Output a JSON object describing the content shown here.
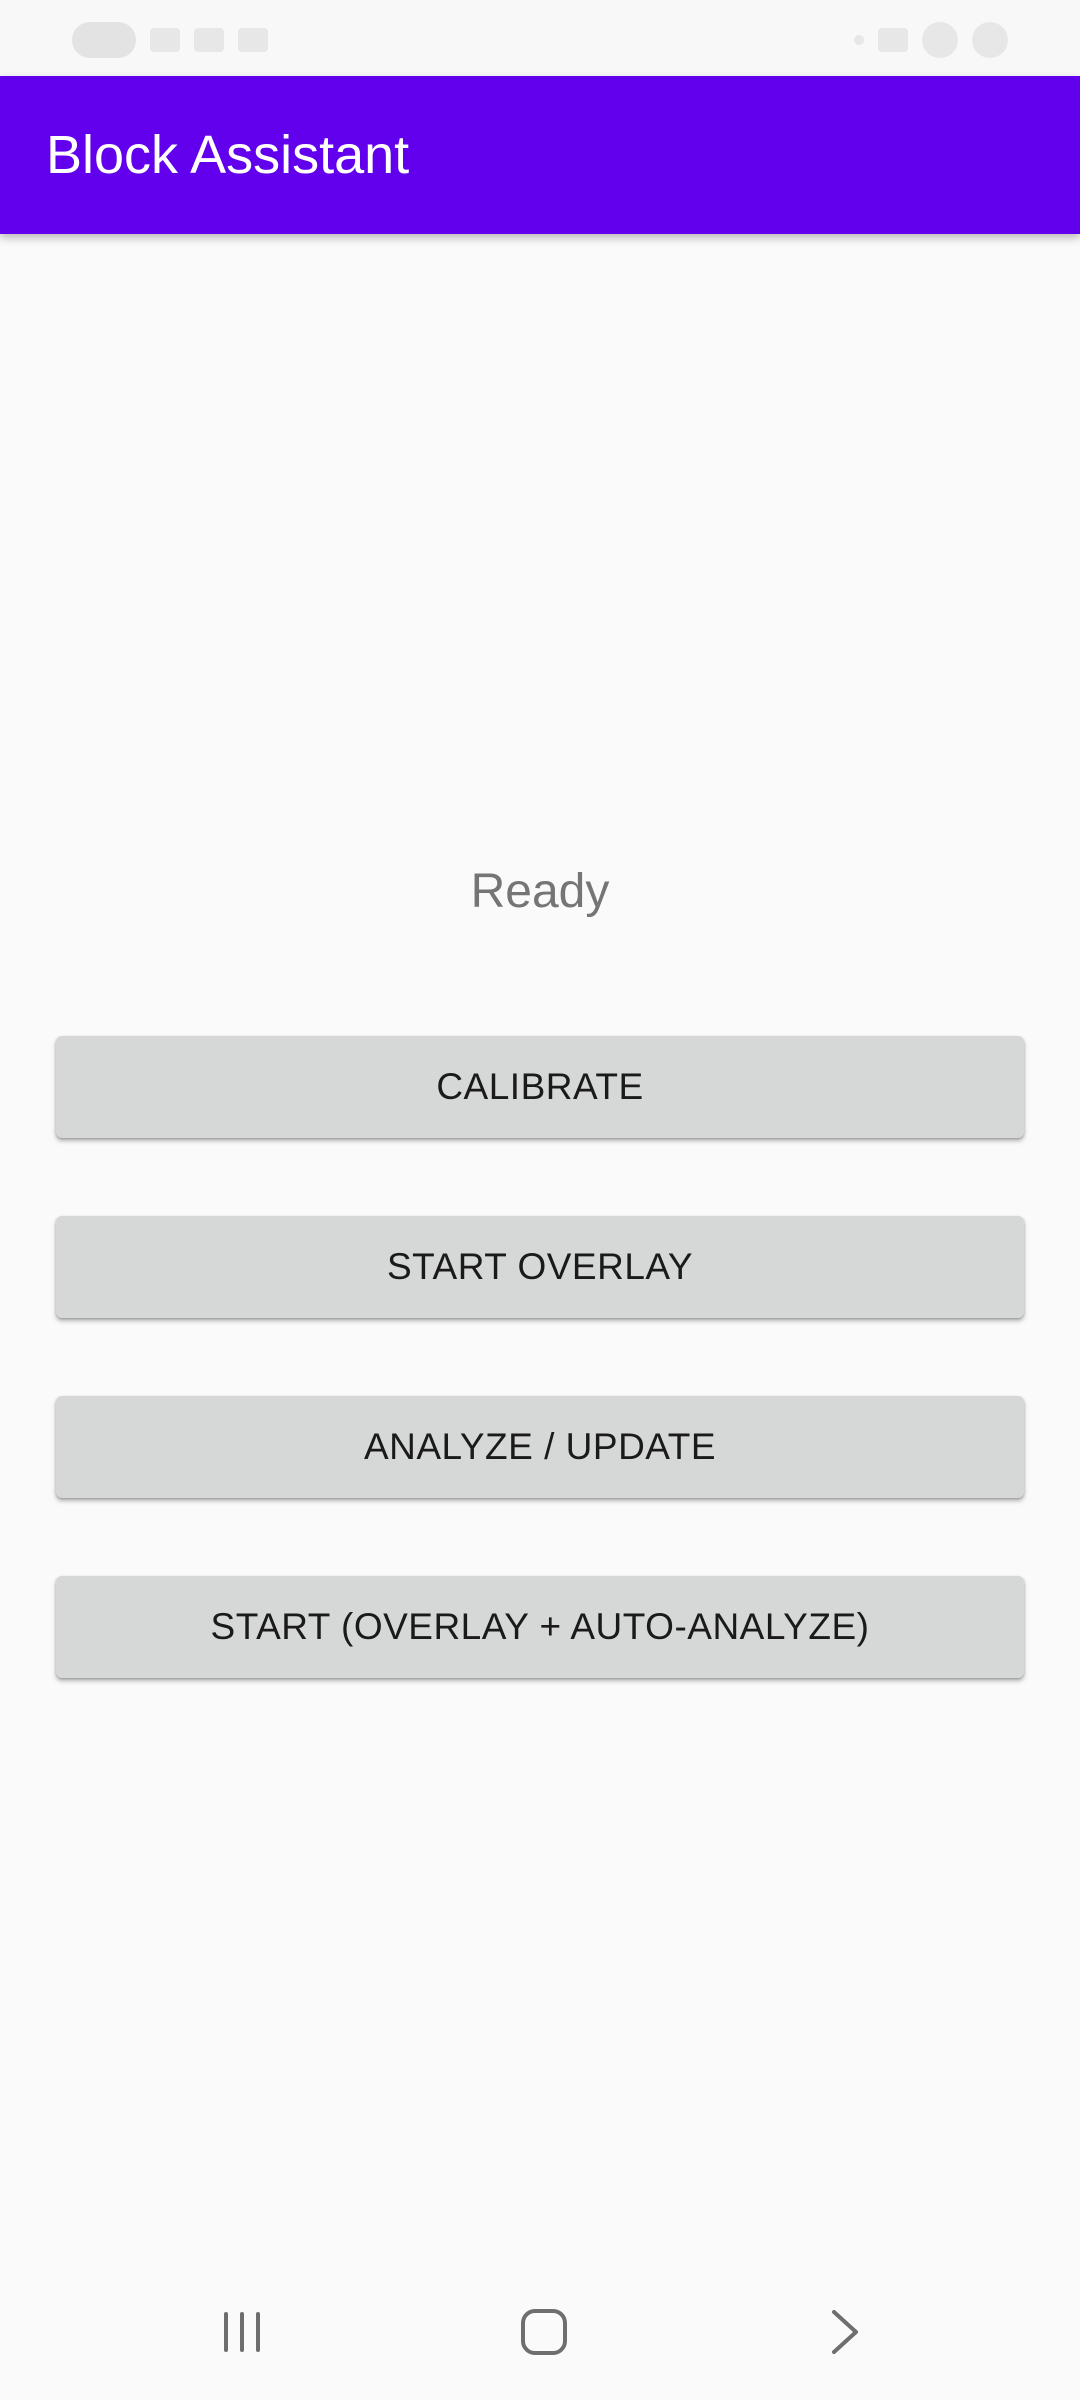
{
  "app": {
    "title": "Block Assistant"
  },
  "status": {
    "text": "Ready"
  },
  "buttons": {
    "calibrate": "CALIBRATE",
    "start_overlay": "START OVERLAY",
    "analyze_update": "ANALYZE / UPDATE",
    "start_auto": "START (OVERLAY + AUTO-ANALYZE)"
  },
  "navigation": {
    "recents_icon": "recents-icon",
    "home_icon": "home-icon",
    "back_icon": "back-icon"
  },
  "colors": {
    "app_bar": "#6200ee",
    "background": "#fafafa",
    "button": "#d6d7d7",
    "status_text": "#757575"
  }
}
